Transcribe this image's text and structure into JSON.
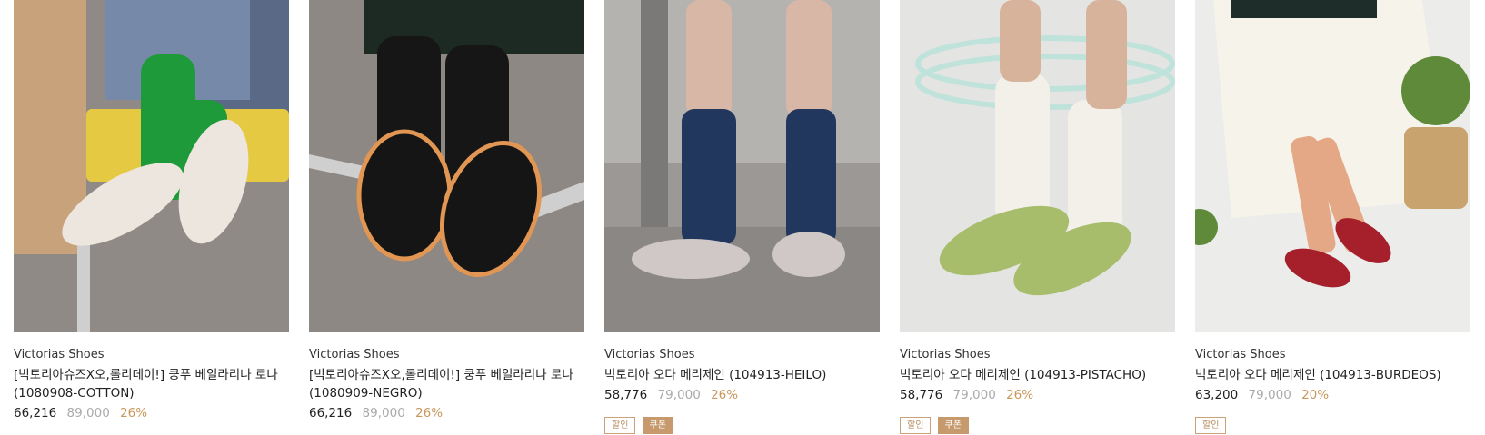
{
  "products": [
    {
      "brand": "Victorias Shoes",
      "title": "[빅토리아슈즈X오,롤리데이!] 쿵푸 베일라리나 로나 (1080908-COTTON)",
      "price": "66,216",
      "original_price": "89,000",
      "discount": "26%",
      "badges": []
    },
    {
      "brand": "Victorias Shoes",
      "title": "[빅토리아슈즈X오,롤리데이!] 쿵푸 베일라리나 로나 (1080909-NEGRO)",
      "price": "66,216",
      "original_price": "89,000",
      "discount": "26%",
      "badges": []
    },
    {
      "brand": "Victorias Shoes",
      "title": "빅토리아 오다 메리제인 (104913-HEILO)",
      "price": "58,776",
      "original_price": "79,000",
      "discount": "26%",
      "badges": [
        "할인",
        "쿠폰"
      ]
    },
    {
      "brand": "Victorias Shoes",
      "title": "빅토리아 오다 메리제인 (104913-PISTACHO)",
      "price": "58,776",
      "original_price": "79,000",
      "discount": "26%",
      "badges": [
        "할인",
        "쿠폰"
      ]
    },
    {
      "brand": "Victorias Shoes",
      "title": "빅토리아 오다 메리제인 (104913-BURDEOS)",
      "price": "63,200",
      "original_price": "79,000",
      "discount": "20%",
      "badges": [
        "할인"
      ]
    }
  ],
  "colors": {
    "discount": "#c9985b",
    "original_price": "#aaaaaa",
    "badge_fill": "#c79a6d"
  }
}
